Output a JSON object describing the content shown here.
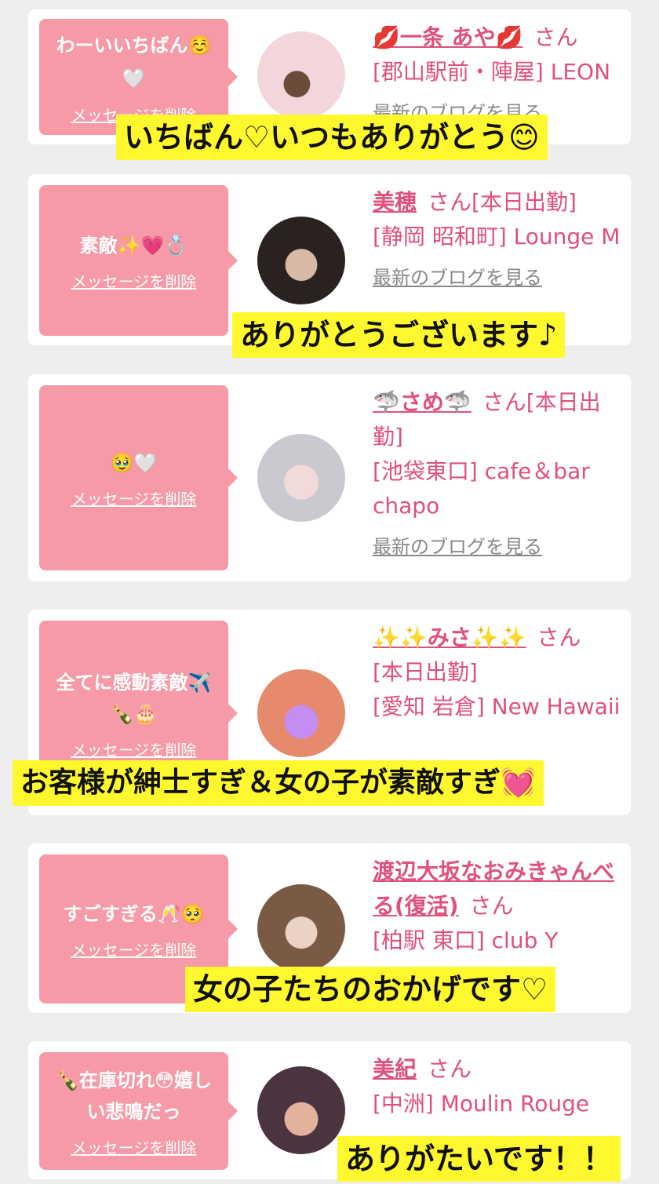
{
  "colors": {
    "bubble": "#f59aa6",
    "pink_text": "#e0507a",
    "highlight": "#fff82e",
    "background": "#eeeeee"
  },
  "san": "さん",
  "delete_label": "メッセージを削除",
  "blog_label": "最新のブログを見る",
  "cards": [
    {
      "message": "わーいいちばん☺️🤍",
      "name": "💋一条 あや💋",
      "suffix": "",
      "area": "[郡山駅前・陣屋]",
      "shop": "LEON",
      "blog": "最新のブログを見る",
      "caption": "いちばん♡いつもありがとう😊"
    },
    {
      "message": "素敵✨💗💍",
      "name": "美穂",
      "suffix": "[本日出勤]",
      "area": "[静岡 昭和町]",
      "shop": "Lounge M",
      "blog": "最新のブログを見る",
      "caption": "ありがとうございます♪"
    },
    {
      "message": "🥹🤍",
      "name": "🦈さめ🦈",
      "suffix": "[本日出勤]",
      "area": "[池袋東口]",
      "shop": "cafe＆bar chapo",
      "blog": "最新のブログを見る",
      "caption": ""
    },
    {
      "message": "全てに感動素敵✈️🍾🎂",
      "name": "✨✨みさ✨✨",
      "suffix": "[本日出勤]",
      "area": "[愛知 岩倉]",
      "shop": "New Hawaii",
      "blog": "",
      "caption": "お客様が紳士すぎ＆女の子が素敵すぎ💓"
    },
    {
      "message": "すごすぎる🥂🥺",
      "name": "渡辺大坂なおみきゃんべる(復活)",
      "suffix": "",
      "area": "[柏駅 東口]",
      "shop": "club Y",
      "blog": "",
      "caption": "女の子たちのおかげです♡"
    },
    {
      "message": "🍾在庫切れ😳嬉しい悲鳴だっ",
      "name": "美紀",
      "suffix": "",
      "area": "[中洲]",
      "shop": "Moulin Rouge",
      "blog": "",
      "caption": "ありがたいです！！"
    }
  ]
}
